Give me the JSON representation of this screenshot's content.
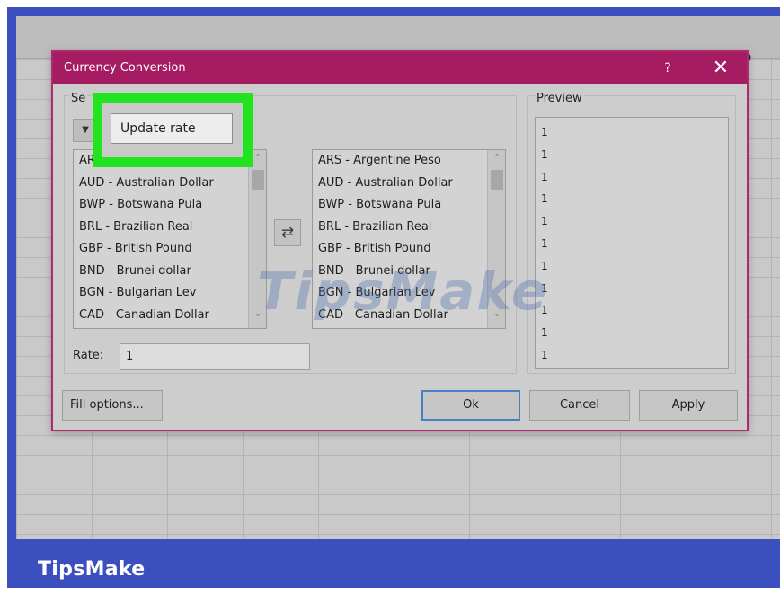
{
  "colors": {
    "frame": "#3b4fbe",
    "titlebar": "#a51c63",
    "highlight": "#22e320",
    "ok_border": "#4a80c6"
  },
  "spreadsheet": {
    "column_header_o": "O"
  },
  "dialog": {
    "title": "Currency Conversion",
    "help_label": "?",
    "close_label": "✕",
    "help_icon": "question-mark-icon",
    "close_icon": "close-x-icon"
  },
  "left_group": {
    "label": "Se",
    "dropdown_arrow": "▼",
    "update_button": "Update rate",
    "list_items": [
      "ARS - Argentine Peso",
      "AUD - Australian Dollar",
      "BWP - Botswana Pula",
      "BRL - Brazilian Real",
      "GBP - British Pound",
      "BND - Brunei dollar",
      "BGN - Bulgarian Lev",
      "CAD - Canadian Dollar"
    ],
    "swap_icon": "⇄"
  },
  "right_list": {
    "items": [
      "ARS - Argentine Peso",
      "AUD - Australian Dollar",
      "BWP - Botswana Pula",
      "BRL - Brazilian Real",
      "GBP - British Pound",
      "BND - Brunei dollar",
      "BGN - Bulgarian Lev",
      "CAD - Canadian Dollar"
    ]
  },
  "rate": {
    "label": "Rate:",
    "value": "1"
  },
  "preview": {
    "label": "Preview",
    "lines": [
      "1",
      "1",
      "1",
      "1",
      "1",
      "1",
      "1",
      "1",
      "1",
      "1",
      "1"
    ]
  },
  "buttons": {
    "fill_options": "Fill options...",
    "ok": "Ok",
    "cancel": "Cancel",
    "apply": "Apply"
  },
  "scroll": {
    "up": "˄",
    "down": "˅"
  },
  "watermark": "TipsMake",
  "brand": "TipsMake"
}
